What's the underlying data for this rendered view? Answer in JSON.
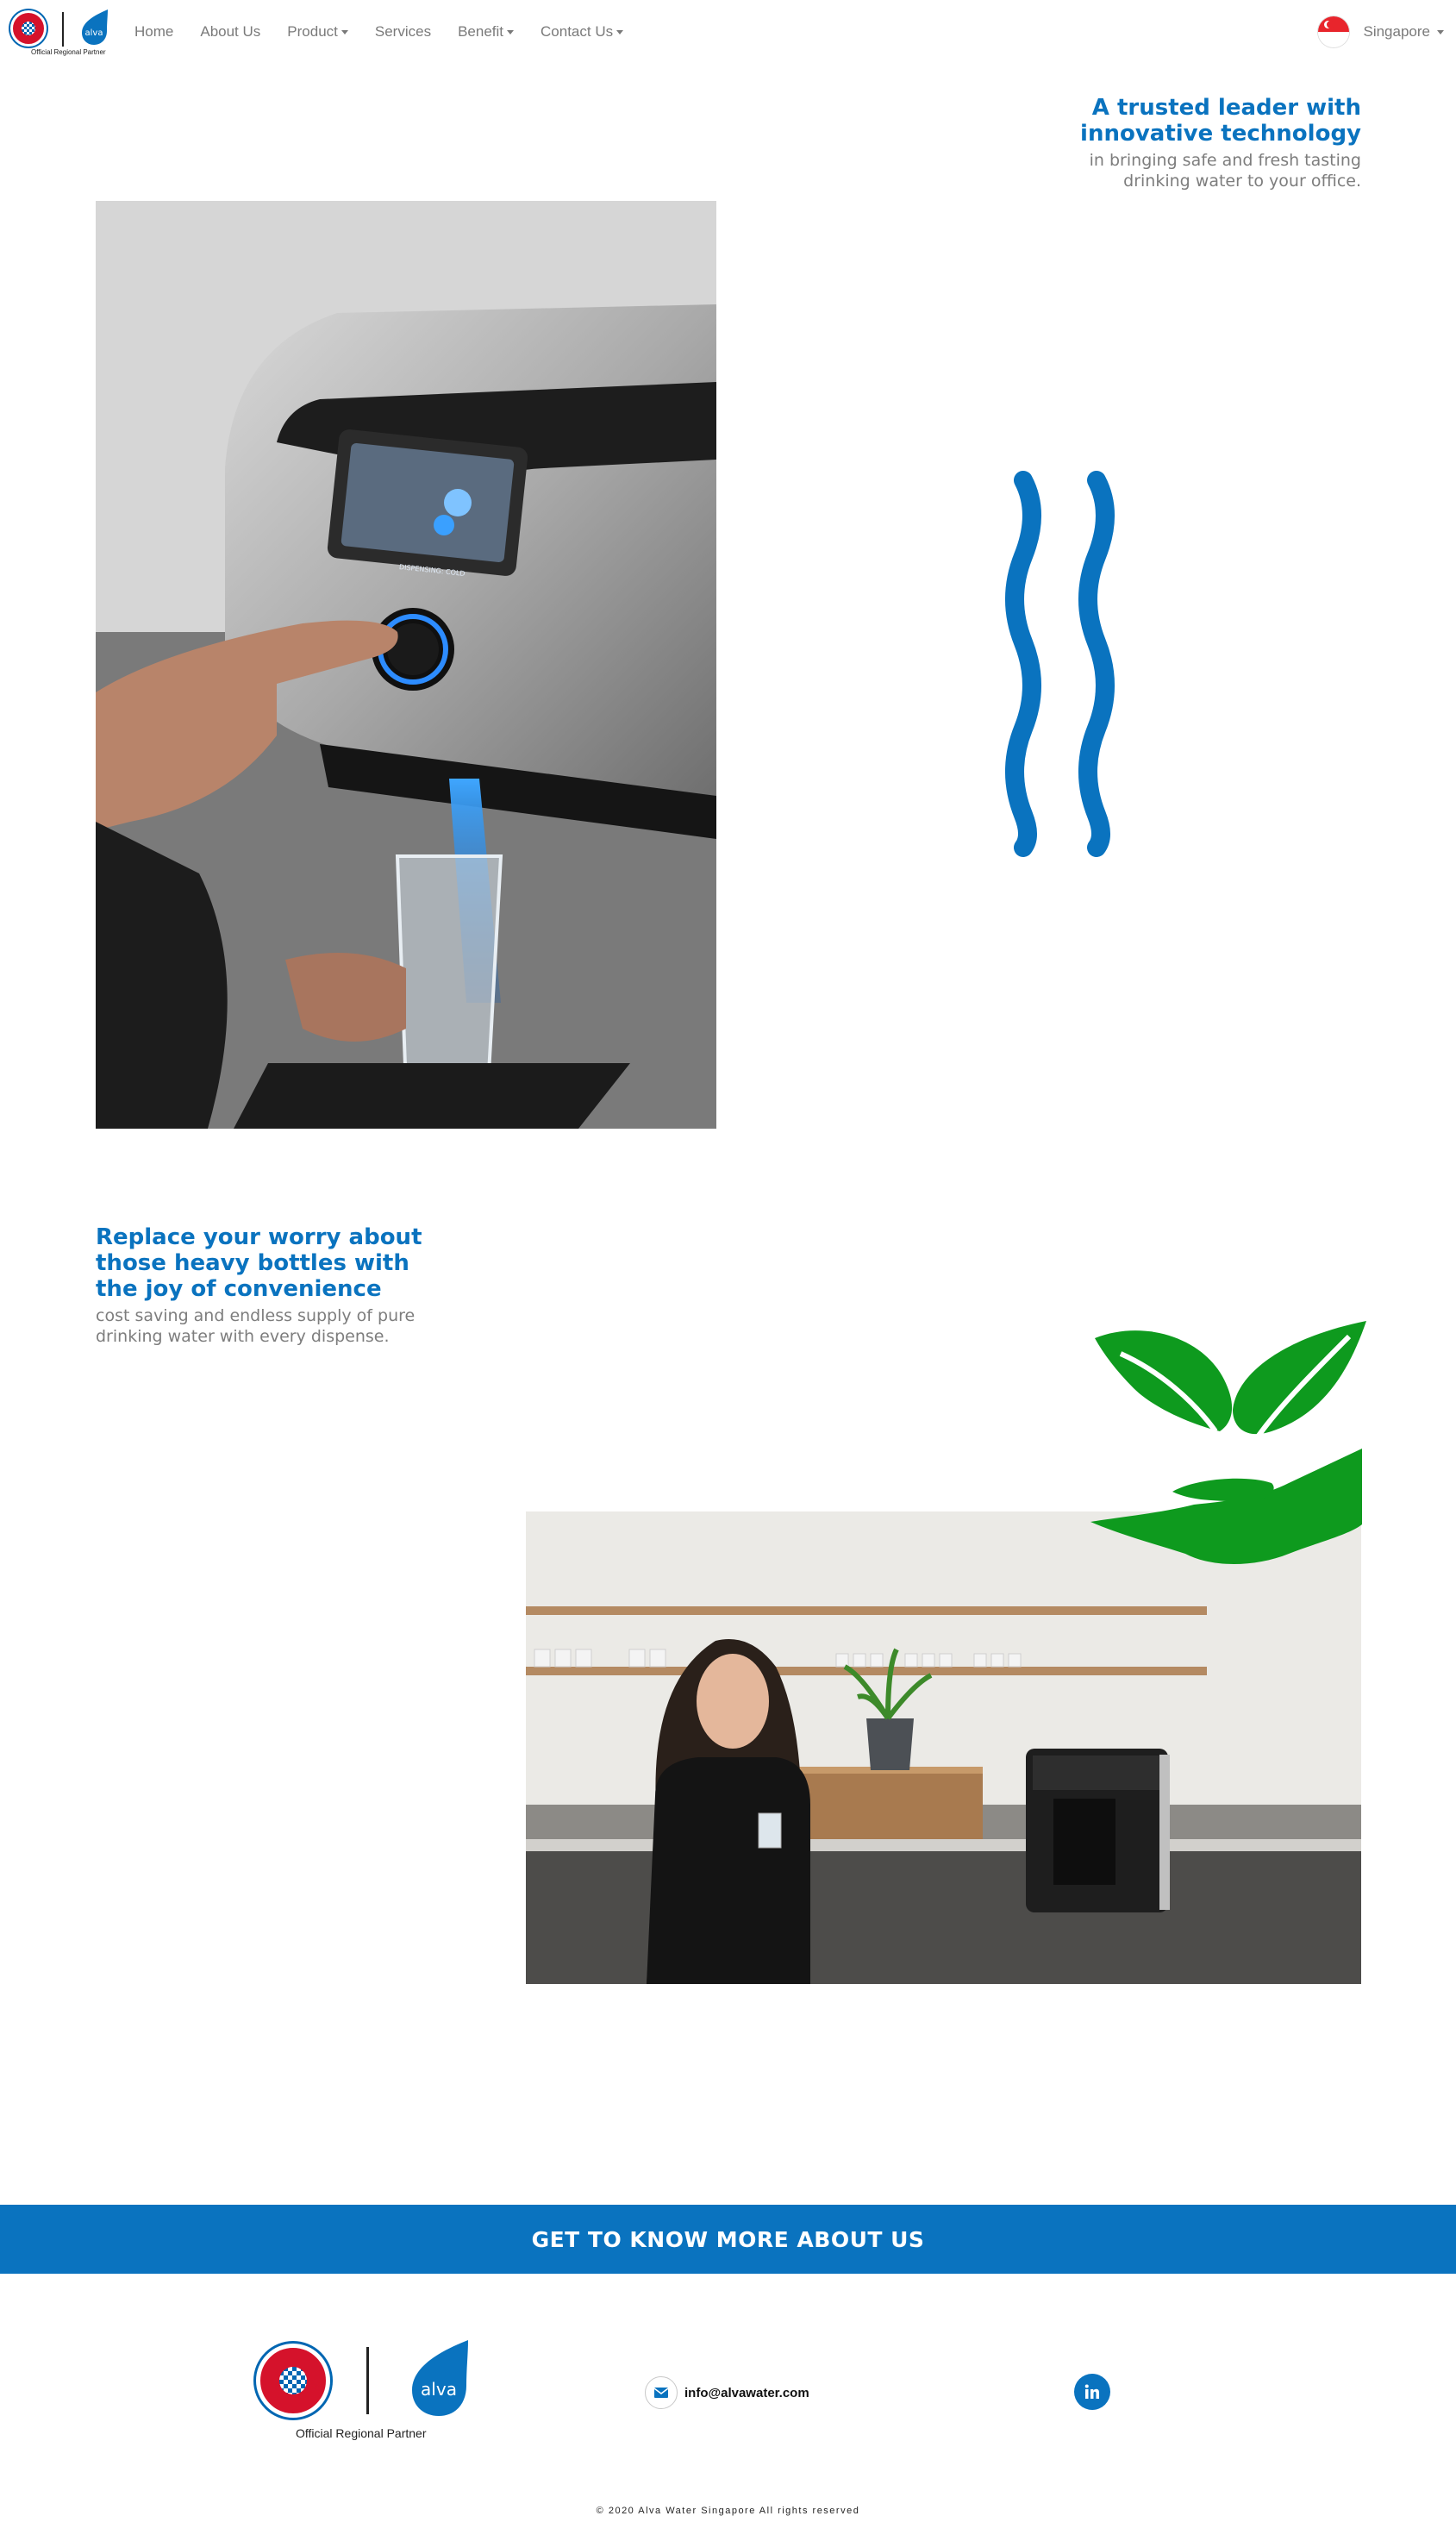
{
  "navbar": {
    "brand_tagline": "Official Regional Partner",
    "links": {
      "home": "Home",
      "about": "About Us",
      "product": "Product",
      "services": "Services",
      "benefit": "Benefit",
      "contact": "Contact Us"
    },
    "country": "Singapore",
    "brand_text": "alva"
  },
  "section1": {
    "title_line1": "A trusted leader with",
    "title_line2": "innovative technology",
    "subtitle_line1": "in bringing safe and fresh tasting",
    "subtitle_line2": "drinking water to your office.",
    "image_icon": "water-dispenser-photo",
    "decor_icon": "water-waves-icon",
    "dispenser_screen_text": "DISPENSING: COLD"
  },
  "section2": {
    "title_line1": "Replace your worry about",
    "title_line2": "those heavy bottles with",
    "title_line3": "the joy of convenience",
    "subtitle_line1": "cost saving and endless supply of pure",
    "subtitle_line2": "drinking water with every dispense.",
    "image_icon": "office-kitchen-photo",
    "decor_icon": "leaves-in-hand-icon"
  },
  "cta": {
    "label": "GET TO KNOW MORE ABOUT US"
  },
  "footer": {
    "partner_tagline": "Official Regional Partner",
    "email": "info@alvawater.com",
    "social_icon": "linkedin-icon",
    "copyright": "© 2020 Alva Water Singapore All rights reserved",
    "brand_text": "alva"
  },
  "colors": {
    "brand_blue": "#0a73bf",
    "leaf_green": "#0e9a1e",
    "text_grey": "#7d7d7d"
  }
}
